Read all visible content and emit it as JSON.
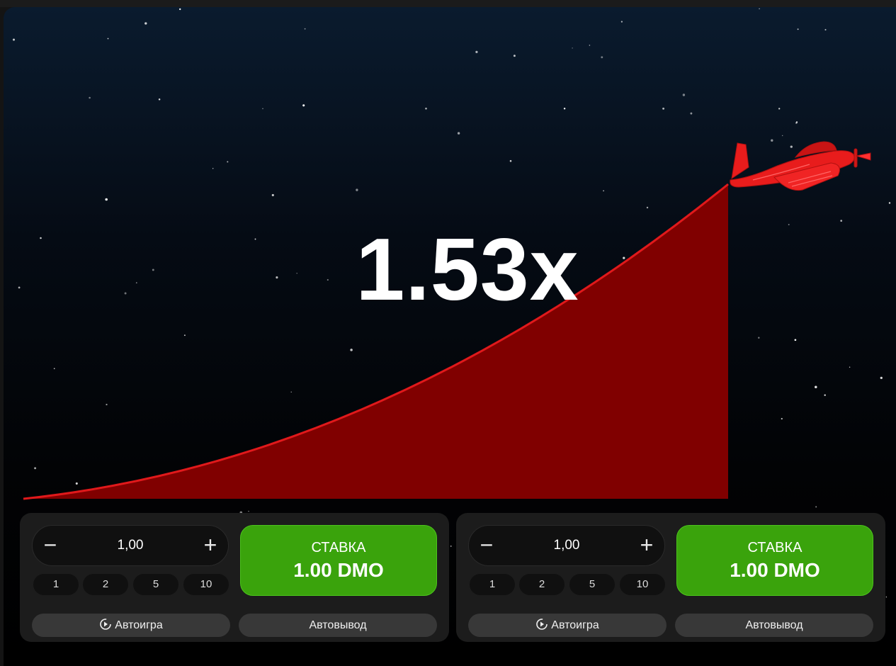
{
  "game": {
    "multiplier": "1.53x",
    "accent_color": "#e0191b",
    "fill_color": "#800000",
    "plane_icon": "plane-icon"
  },
  "panels": [
    {
      "amount": "1,00",
      "minus_symbol": "−",
      "plus_symbol": "+",
      "quick_amounts": [
        "1",
        "2",
        "5",
        "10"
      ],
      "bet_label": "СТАВКА",
      "bet_amount": "1.00 DMO",
      "autoplay_label": "Автоигра",
      "autocashout_label": "Автовывод"
    },
    {
      "amount": "1,00",
      "minus_symbol": "−",
      "plus_symbol": "+",
      "quick_amounts": [
        "1",
        "2",
        "5",
        "10"
      ],
      "bet_label": "СТАВКА",
      "bet_amount": "1.00 DMO",
      "autoplay_label": "Автоигра",
      "autocashout_label": "Автовывод"
    }
  ],
  "colors": {
    "bet_green": "#3aa30c",
    "panel_bg": "#1c1c1c",
    "pill_bg": "#383838"
  }
}
